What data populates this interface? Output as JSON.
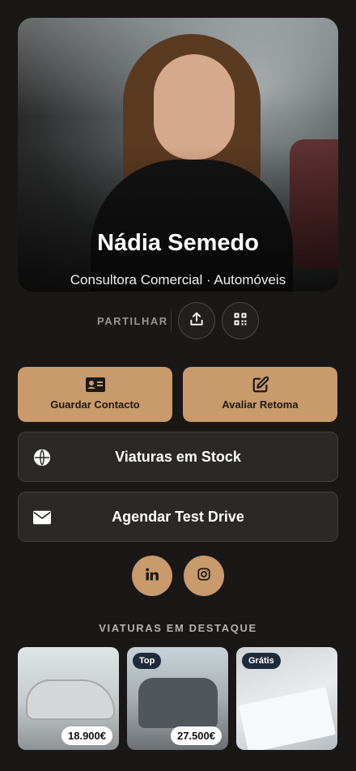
{
  "profile": {
    "name": "Nádia Semedo",
    "role": "Consultora Comercial · Automóveis"
  },
  "share": {
    "label": "PARTILHAR",
    "share_icon": "upload-icon",
    "qr_icon": "qr-code-icon"
  },
  "actions": {
    "save_contact": "Guardar Contacto",
    "trade_in": "Avaliar Retoma",
    "stock": "Viaturas em Stock",
    "test_drive": "Agendar Test Drive"
  },
  "social": {
    "items": [
      "linkedin-icon",
      "instagram-icon"
    ]
  },
  "featured": {
    "title": "VIATURAS EM DESTAQUE",
    "items": [
      {
        "price": "18.900€",
        "tag": ""
      },
      {
        "price": "27.500€",
        "tag": "Top"
      },
      {
        "price": "",
        "tag": "Grátis"
      }
    ]
  },
  "colors": {
    "background": "#1a1817",
    "accent": "#c89a6c",
    "card": "#2b2926"
  }
}
